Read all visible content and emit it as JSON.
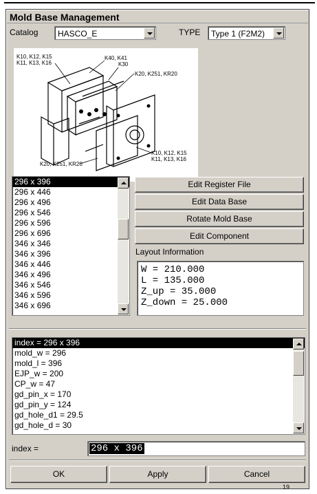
{
  "window": {
    "title": "Mold Base Management"
  },
  "catalog": {
    "label": "Catalog",
    "value": "HASCO_E"
  },
  "type": {
    "label": "TYPE",
    "value": "Type 1 (F2M2)"
  },
  "diagram_labels": [
    "K10, K12, K15",
    "K11, K13, K16",
    "K40, K41",
    "K30",
    "K20, K251, KR20",
    "K10, K12, K15",
    "K11, K13, K16",
    "K20, K251, KR20"
  ],
  "sizes": [
    "296 x 396",
    "296 x 446",
    "296 x 496",
    "296 x 546",
    "296 x 596",
    "296 x 696",
    "346 x 346",
    "346 x 396",
    "346 x 446",
    "346 x 496",
    "346 x 546",
    "346 x 596",
    "346 x 696"
  ],
  "buttons": {
    "edit_register": "Edit Register File",
    "edit_database": "Edit Data Base",
    "rotate": "Rotate Mold Base",
    "edit_component": "Edit Component"
  },
  "layout_info": {
    "label": "Layout Information",
    "lines": [
      "W = 210.000",
      "L = 135.000",
      "Z_up = 35.000",
      "Z_down = 25.000"
    ]
  },
  "params": [
    "index = 296 x 396",
    "mold_w = 296",
    "mold_l = 396",
    "EJP_w = 200",
    "CP_w = 47",
    "gd_pin_x = 170",
    "gd_pin_y = 124",
    "gd_hole_d1 = 29.5",
    "gd_hole_d = 30"
  ],
  "index_field": {
    "label": "index =",
    "value": "296 x 396"
  },
  "footer": {
    "ok": "OK",
    "apply": "Apply",
    "cancel": "Cancel"
  },
  "page_number": "19"
}
